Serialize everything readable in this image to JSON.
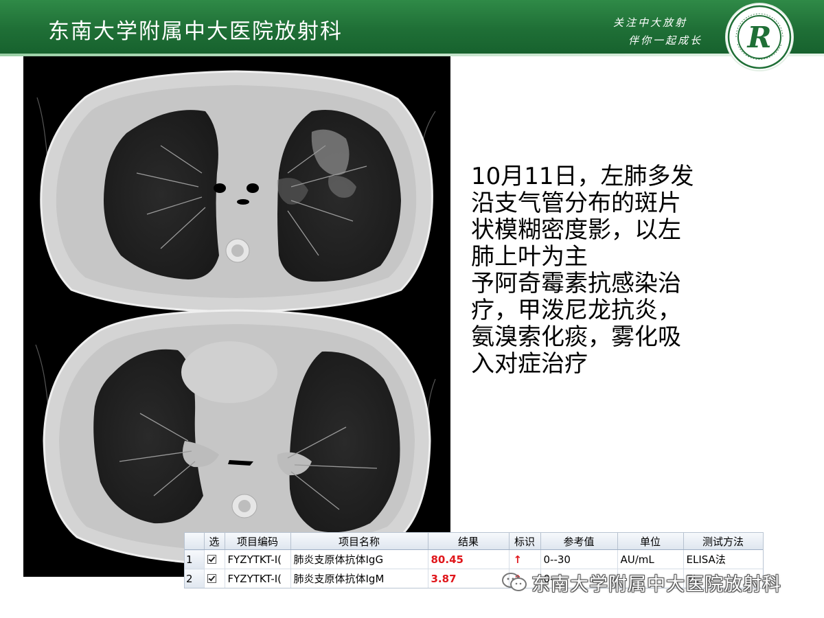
{
  "header": {
    "title": "东南大学附属中大医院放射科",
    "slogan_line1": "关注中大放射",
    "slogan_line2": "伴你一起成长",
    "logo_letter": "R",
    "colors": {
      "green_dark": "#17622e",
      "green_light": "#2f8a47"
    }
  },
  "ct_image": {
    "label": "chest-ct-axial-slices"
  },
  "description": {
    "lines": [
      "10月11日，左肺多发",
      "沿支气管分布的斑片",
      "状模糊密度影，以左",
      "肺上叶为主",
      "予阿奇霉素抗感染治",
      "疗，甲泼尼龙抗炎，",
      "氨溴索化痰，雾化吸",
      "入对症治疗"
    ]
  },
  "lab_table": {
    "headers": [
      "",
      "选",
      "项目编码",
      "项目名称",
      "结果",
      "标识",
      "参考值",
      "单位",
      "测试方法"
    ],
    "rows": [
      {
        "num": "1",
        "code": "FYZYTKT-I(",
        "name": "肺炎支原体抗体IgG",
        "result": "80.45",
        "flag": "↑",
        "ref": "0--30",
        "unit": "AU/mL",
        "method": "ELISA法"
      },
      {
        "num": "2",
        "code": "FYZYTKT-I(",
        "name": "肺炎支原体抗体IgM",
        "result": "3.87",
        "flag": "↑",
        "ref": "0-",
        "unit": "",
        "method": "EL"
      }
    ],
    "colors": {
      "highlight": "#e0161b"
    }
  },
  "watermark": {
    "text": "东南大学附属中大医院放射科",
    "icon": "wechat-icon"
  }
}
